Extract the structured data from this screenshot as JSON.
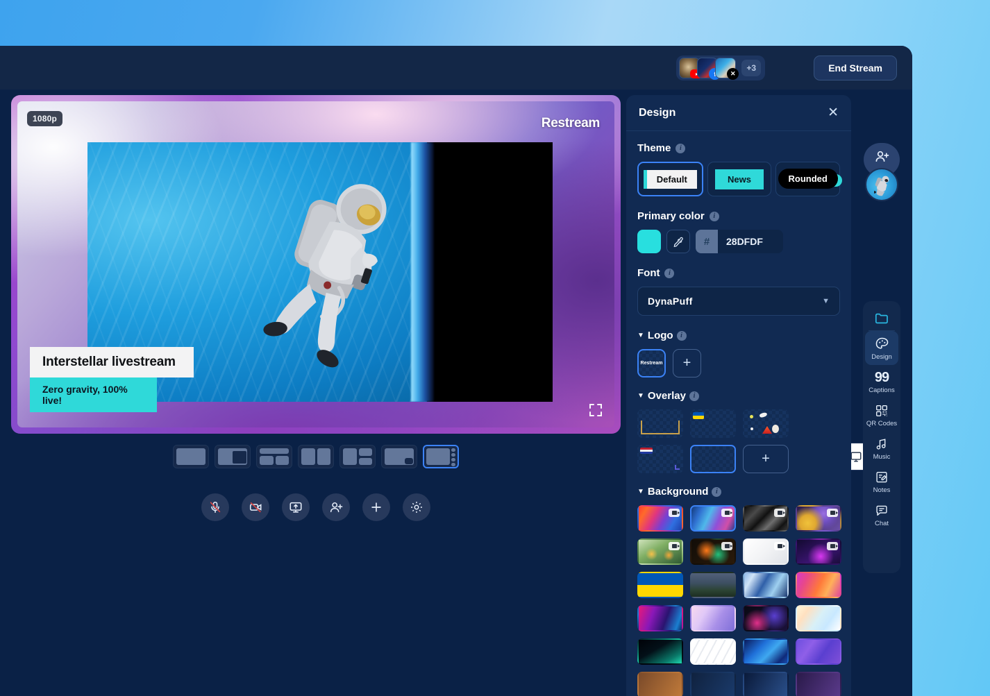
{
  "app": {
    "background_gradient": [
      "#3ea3ee",
      "#a9d8f7",
      "#62c8f6"
    ],
    "window_bg": "#0a2146"
  },
  "topbar": {
    "end_stream_label": "End Stream",
    "plus_count_label": "+3",
    "destinations": [
      {
        "name": "youtube-destination",
        "badge": "youtube-icon"
      },
      {
        "name": "facebook-destination",
        "badge": "facebook-icon"
      },
      {
        "name": "x-destination",
        "badge": "x-icon"
      }
    ]
  },
  "stage": {
    "resolution_badge": "1080p",
    "watermark": "Restream",
    "lower_third": {
      "title": "Interstellar livestream",
      "subtitle": "Zero gravity, 100% live!"
    },
    "expand_icon": "fullscreen-icon"
  },
  "layouts": {
    "items": [
      {
        "name": "layout-solo",
        "selected": false
      },
      {
        "name": "layout-picture-in-picture",
        "selected": false
      },
      {
        "name": "layout-two-up-banner",
        "selected": false
      },
      {
        "name": "layout-split-two",
        "selected": false
      },
      {
        "name": "layout-leader-plus-two",
        "selected": false
      },
      {
        "name": "layout-corner-small",
        "selected": false
      },
      {
        "name": "layout-sidebar-strip",
        "selected": true
      }
    ],
    "device_toggle": [
      {
        "name": "desktop-view",
        "icon": "monitor-icon",
        "selected": true
      },
      {
        "name": "mobile-view",
        "icon": "phone-icon",
        "selected": false
      }
    ]
  },
  "controls": [
    {
      "name": "microphone-toggle",
      "icon": "mic-off-icon",
      "state": "muted"
    },
    {
      "name": "camera-toggle",
      "icon": "camera-off-icon",
      "state": "off"
    },
    {
      "name": "screen-share-button",
      "icon": "screen-share-icon"
    },
    {
      "name": "invite-guest-button",
      "icon": "add-person-icon"
    },
    {
      "name": "add-media-button",
      "icon": "plus-icon"
    },
    {
      "name": "settings-button",
      "icon": "gear-icon"
    }
  ],
  "panel": {
    "title": "Design",
    "close_icon": "close-icon",
    "theme": {
      "label": "Theme",
      "options": [
        {
          "label": "Default",
          "selected": true
        },
        {
          "label": "News",
          "selected": false
        },
        {
          "label": "Rounded",
          "selected": false
        }
      ]
    },
    "primary_color": {
      "label": "Primary color",
      "hex": "28DFDF",
      "hash": "#",
      "swatch_color": "#28DFDF",
      "picker_icon": "eyedropper-icon"
    },
    "font": {
      "label": "Font",
      "value": "DynaPuff",
      "chevron": "chevron-down-icon"
    },
    "logo": {
      "label": "Logo",
      "items": [
        {
          "label": "Restream",
          "selected": true
        }
      ],
      "add_label": "+"
    },
    "overlay": {
      "label": "Overlay",
      "items": [
        {
          "name": "overlay-gold-frame",
          "selected": false
        },
        {
          "name": "overlay-ukraine-flag",
          "selected": false
        },
        {
          "name": "overlay-party-confetti",
          "selected": false
        },
        {
          "name": "overlay-usa-flag",
          "selected": false
        },
        {
          "name": "overlay-none",
          "selected": true
        }
      ],
      "add_label": "+"
    },
    "background": {
      "label": "Background",
      "items": [
        {
          "name": "bg-warm-ribbons",
          "video": true,
          "selected": false,
          "css": "linear-gradient(120deg,#ff3d2e 0%,#ff6a2b 16%,#e0357f 38%,#7b3fd0 58%,#2f6fe0 78%,#1e3faa 100%)"
        },
        {
          "name": "bg-cool-ribbons",
          "video": true,
          "selected": true,
          "css": "linear-gradient(115deg,#123a7a 0%,#2f6fd0 20%,#4fb8ea 40%,#8f4fd8 62%,#d04fa8 82%,#2a3a8a 100%)"
        },
        {
          "name": "bg-black-silk",
          "video": true,
          "selected": false,
          "css": "linear-gradient(135deg,#0a0a0a 0%,#4a4a4a 25%,#101010 45%,#6e6e6e 65%,#121212 85%,#3a3a3a 100%)"
        },
        {
          "name": "bg-purple-spheres",
          "video": true,
          "selected": false,
          "css": "radial-gradient(circle at 25% 70%,#f0c23a 0%,#e0a830 22%,rgba(224,168,48,0) 46%),radial-gradient(circle at 62% 30%,#9b6fe0 0%,#6f4fc0 28%,rgba(111,79,192,0) 52%),linear-gradient(135deg,#2a1b4a,#6b4fa8)"
        },
        {
          "name": "bg-green-lilies",
          "video": true,
          "selected": false,
          "css": "radial-gradient(circle at 30% 60%,#f5c04a 0%,rgba(245,192,74,0) 18%),radial-gradient(circle at 70% 65%,#f0a83a 0%,rgba(240,168,58,0) 16%),linear-gradient(150deg,#cfe3bb 0%,#7fae63 40%,#2f5a33 100%)"
        },
        {
          "name": "bg-bird-of-paradise",
          "video": true,
          "selected": false,
          "css": "radial-gradient(circle at 35% 45%,#ff7a1a 0%,rgba(255,122,26,0) 34%),radial-gradient(circle at 62% 62%,#24c07a 0%,rgba(36,192,122,0) 38%),linear-gradient(140deg,#120d08,#2a1a0a)"
        },
        {
          "name": "bg-white-plain",
          "video": true,
          "selected": false,
          "css": "linear-gradient(135deg,#ffffff 0%,#f2f3f5 50%,#dfe2e8 100%)"
        },
        {
          "name": "bg-neon-dots",
          "video": true,
          "selected": false,
          "css": "radial-gradient(circle at 55% 70%,#d838f0 0%,rgba(216,56,240,0) 45%),linear-gradient(150deg,#120a30,#3a1470 60%,#1a0d3a 100%)"
        },
        {
          "name": "bg-ukraine-flag",
          "video": false,
          "selected": false,
          "css": "linear-gradient(180deg,#0057b7 0%,#0057b7 50%,#ffd700 50%,#ffd700 100%)"
        },
        {
          "name": "bg-city-dusk",
          "video": false,
          "selected": false,
          "css": "linear-gradient(180deg,#52607a 0%,#3d4f62 42%,#2c4434 72%,#1d2e22 100%)"
        },
        {
          "name": "bg-blue-silk",
          "video": false,
          "selected": false,
          "css": "linear-gradient(120deg,#8fb8e8 0%,#cfe3f7 18%,#2f5fa8 45%,#9fd0f0 70%,#1d3a72 100%)"
        },
        {
          "name": "bg-sunset-blend",
          "video": false,
          "selected": false,
          "css": "linear-gradient(115deg,#d838c8 0%,#e8488a 22%,#ff7a3a 52%,#ffb05a 72%,#e0489a 100%)"
        },
        {
          "name": "bg-magenta-aurora",
          "video": false,
          "selected": false,
          "css": "linear-gradient(110deg,#e8187a 0%,#8a18b8 32%,#2a1470 62%,#1a7fd0 88%,#0d2a6a 100%)"
        },
        {
          "name": "bg-pastel-lavender",
          "video": false,
          "selected": false,
          "css": "linear-gradient(120deg,#f7d8ee 0%,#e0c8f7 30%,#a88fe8 62%,#7f6fd8 100%)"
        },
        {
          "name": "bg-dark-nebula",
          "video": false,
          "selected": false,
          "css": "radial-gradient(circle at 30% 70%,#e0308a 0%,rgba(224,48,138,0) 40%),radial-gradient(circle at 70% 40%,#5a3fd0 0%,rgba(90,63,208,0) 45%),linear-gradient(120deg,#0a0a14,#1a1038)"
        },
        {
          "name": "bg-light-prism",
          "video": false,
          "selected": false,
          "css": "linear-gradient(125deg,#fff6d8 0%,#ffe0c0 22%,#d8f0f7 50%,#c8e8ff 72%,#ffffff 100%)"
        },
        {
          "name": "bg-teal-fade",
          "video": false,
          "selected": false,
          "css": "linear-gradient(150deg,#000208 0%,#031018 40%,#0a7a6a 78%,#1fd8b0 100%)"
        },
        {
          "name": "bg-white-waves",
          "video": false,
          "selected": false,
          "css": "repeating-linear-gradient(118deg,#ffffff 0 9px,#e8ebf0 9px 11px)"
        },
        {
          "name": "bg-blue-wave",
          "video": false,
          "selected": false,
          "css": "linear-gradient(135deg,#0a1a5a 0%,#1f6fd8 35%,#3fa8f0 58%,#0f2a7a 85%,#1a4fb0 100%)"
        },
        {
          "name": "bg-violet-blend",
          "video": false,
          "selected": false,
          "css": "linear-gradient(125deg,#6f4fe0 0%,#8f5fe8 30%,#5a3fd0 60%,#7f4fd8 100%)"
        },
        {
          "name": "bg-row-peek-a",
          "video": false,
          "selected": false,
          "css": "linear-gradient(120deg,#7a4a2a,#c07a3a)"
        },
        {
          "name": "bg-row-peek-b",
          "video": false,
          "selected": false,
          "css": "linear-gradient(120deg,#10223f,#1a3a6a)"
        },
        {
          "name": "bg-row-peek-c",
          "video": false,
          "selected": false,
          "css": "linear-gradient(120deg,#0a1a3a,#2a4f8a)"
        },
        {
          "name": "bg-row-peek-d",
          "video": false,
          "selected": false,
          "css": "linear-gradient(120deg,#2a1a4a,#5a3a8a)"
        }
      ]
    }
  },
  "rail": {
    "invite_icon": "add-person-icon",
    "avatar_name": "self-avatar",
    "items": [
      {
        "label": "",
        "icon": "folder-icon",
        "name": "rail-item-media",
        "active": false
      },
      {
        "label": "Design",
        "icon": "palette-icon",
        "name": "rail-item-design",
        "active": true
      },
      {
        "label": "Captions",
        "icon": "quote-icon",
        "name": "rail-item-captions",
        "active": false
      },
      {
        "label": "QR Codes",
        "icon": "qr-icon",
        "name": "rail-item-qr-codes",
        "active": false
      },
      {
        "label": "Music",
        "icon": "music-note-icon",
        "name": "rail-item-music",
        "active": false
      },
      {
        "label": "Notes",
        "icon": "notes-icon",
        "name": "rail-item-notes",
        "active": false
      },
      {
        "label": "Chat",
        "icon": "chat-icon",
        "name": "rail-item-chat",
        "active": false
      }
    ]
  }
}
